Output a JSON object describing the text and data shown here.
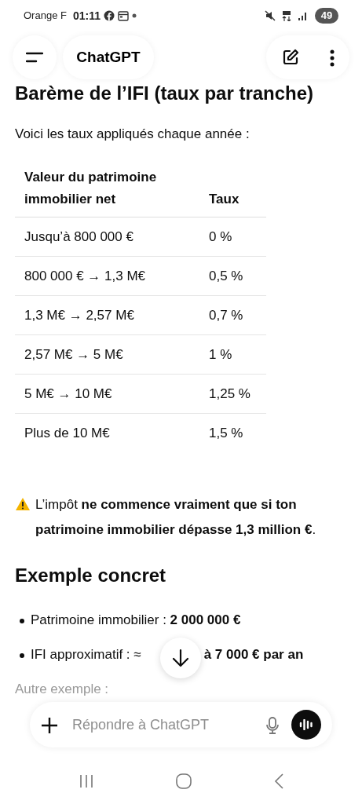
{
  "status_bar": {
    "carrier": "Orange F",
    "time": "01:11",
    "battery": "49"
  },
  "header": {
    "title": "ChatGPT"
  },
  "heading": "Barème de l’IFI (taux par tranche)",
  "intro": "Voici les taux appliqués chaque année :",
  "table": {
    "columns": [
      "Valeur du patrimoine immobilier net",
      "Taux"
    ],
    "rows": [
      [
        "Jusqu’à 800 000 €",
        "0 %"
      ],
      [
        "800 000 € → 1,3 M€",
        "0,5 %"
      ],
      [
        "1,3 M€ → 2,57 M€",
        "0,7 %"
      ],
      [
        "2,57 M€ → 5 M€",
        "1 %"
      ],
      [
        "5 M€ → 10 M€",
        "1,25 %"
      ],
      [
        "Plus de 10 M€",
        "1,5 %"
      ]
    ]
  },
  "warning": "L’impôt **ne commence vraiment que si ton patrimoine immobilier dépasse 1,3 million €**.",
  "subheading": "Exemple concret",
  "bullets": [
    {
      "parts": [
        "Patrimoine immobilier : **2 000 000 €**"
      ]
    },
    {
      "parts": [
        "IFI approximatif : ≈",
        "**à 7 000 € par an**"
      ]
    }
  ],
  "faded": "Autre exemple :",
  "composer": {
    "placeholder": "Répondre à ChatGPT"
  }
}
